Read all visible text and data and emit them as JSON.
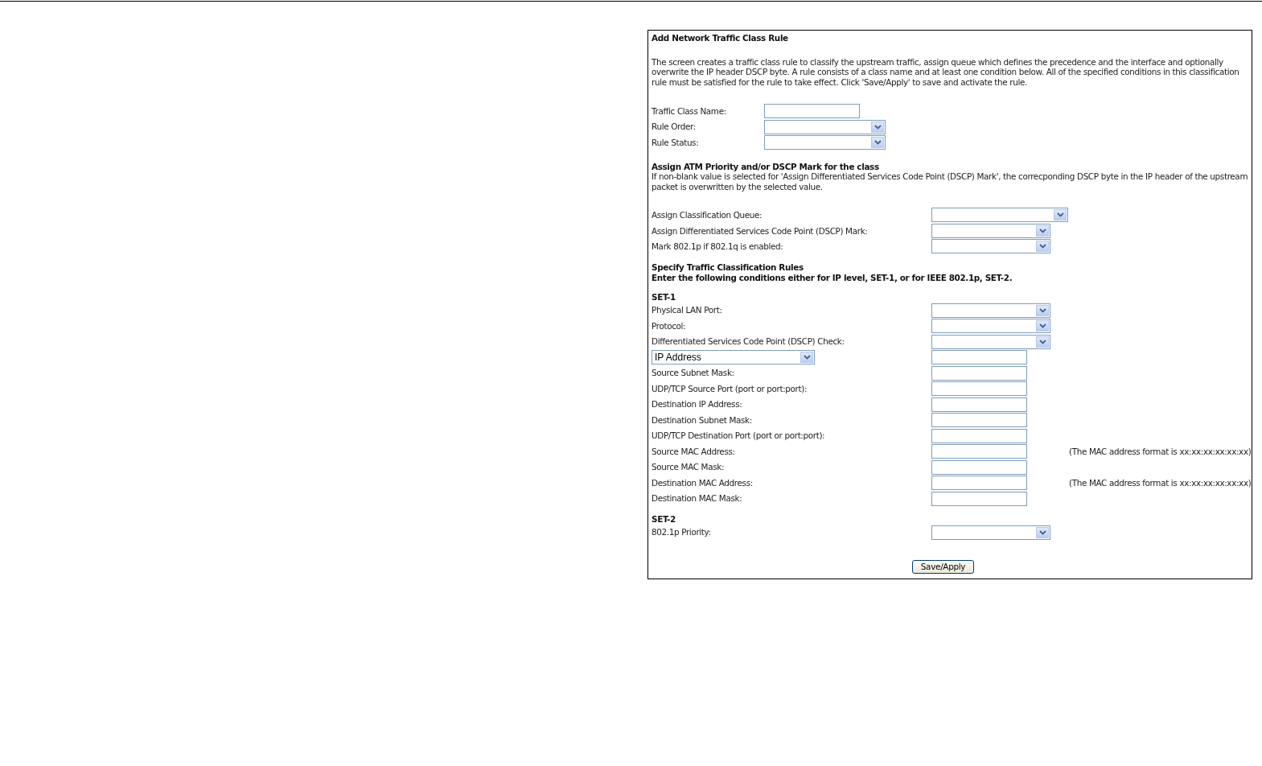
{
  "title": "Add Network Traffic Class Rule",
  "description": "The screen creates a traffic class rule to classify the upstream traffic, assign queue which defines the precedence and the interface and optionally overwrite the IP header DSCP byte. A rule consists of a class name and at least one condition below. All of the specified conditions in this classification rule must be satisfied for the rule to take effect. Click 'Save/Apply' to save and activate the rule.",
  "basic_fields": [
    {
      "label": "Traffic Class Name:",
      "kind": "text"
    },
    {
      "label": "Rule Order:",
      "kind": "select"
    },
    {
      "label": "Rule Status:",
      "kind": "select"
    }
  ],
  "assign": {
    "heading": "Assign ATM Priority and/or DSCP Mark for the class",
    "description": "If non-blank value is selected for 'Assign Differentiated Services Code Point (DSCP) Mark', the correcponding DSCP byte in the IP header of the upstream packet is overwritten by the selected value.",
    "fields": [
      {
        "label": "Assign Classification Queue:",
        "kind": "select"
      },
      {
        "label": "Assign Differentiated Services Code Point (DSCP) Mark:",
        "kind": "select"
      },
      {
        "label": "Mark 802.1p if 802.1q is enabled:",
        "kind": "select"
      }
    ]
  },
  "rules": {
    "heading": "Specify Traffic Classification Rules",
    "subheading": "Enter the following conditions either for IP level, SET-1, or for IEEE 802.1p, SET-2.",
    "sets": [
      {
        "title": "SET-1",
        "fields": [
          {
            "label": "Physical LAN Port:",
            "kind": "select"
          },
          {
            "label": "Protocol:",
            "kind": "select"
          },
          {
            "label": "Differentiated Services Code Point (DSCP) Check:",
            "kind": "select"
          },
          {
            "label": "IP Address",
            "kind": "label-select"
          },
          {
            "label": "Source Subnet Mask:",
            "kind": "text"
          },
          {
            "label": "UDP/TCP Source Port (port or port:port):",
            "kind": "text"
          },
          {
            "label": "Destination IP Address:",
            "kind": "text"
          },
          {
            "label": "Destination Subnet Mask:",
            "kind": "text"
          },
          {
            "label": "UDP/TCP Destination Port (port or port:port):",
            "kind": "text"
          },
          {
            "label": "Source MAC Address:",
            "kind": "text",
            "note": "(The MAC address format is xx:xx:xx:xx:xx:xx)"
          },
          {
            "label": "Source MAC Mask:",
            "kind": "text"
          },
          {
            "label": "Destination MAC Address:",
            "kind": "text",
            "note": "(The MAC address format is xx:xx:xx:xx:xx:xx)"
          },
          {
            "label": "Destination MAC Mask:",
            "kind": "text"
          }
        ]
      },
      {
        "title": "SET-2",
        "fields": [
          {
            "label": "802.1p Priority:",
            "kind": "select"
          }
        ]
      }
    ]
  },
  "save_button": "Save/Apply"
}
